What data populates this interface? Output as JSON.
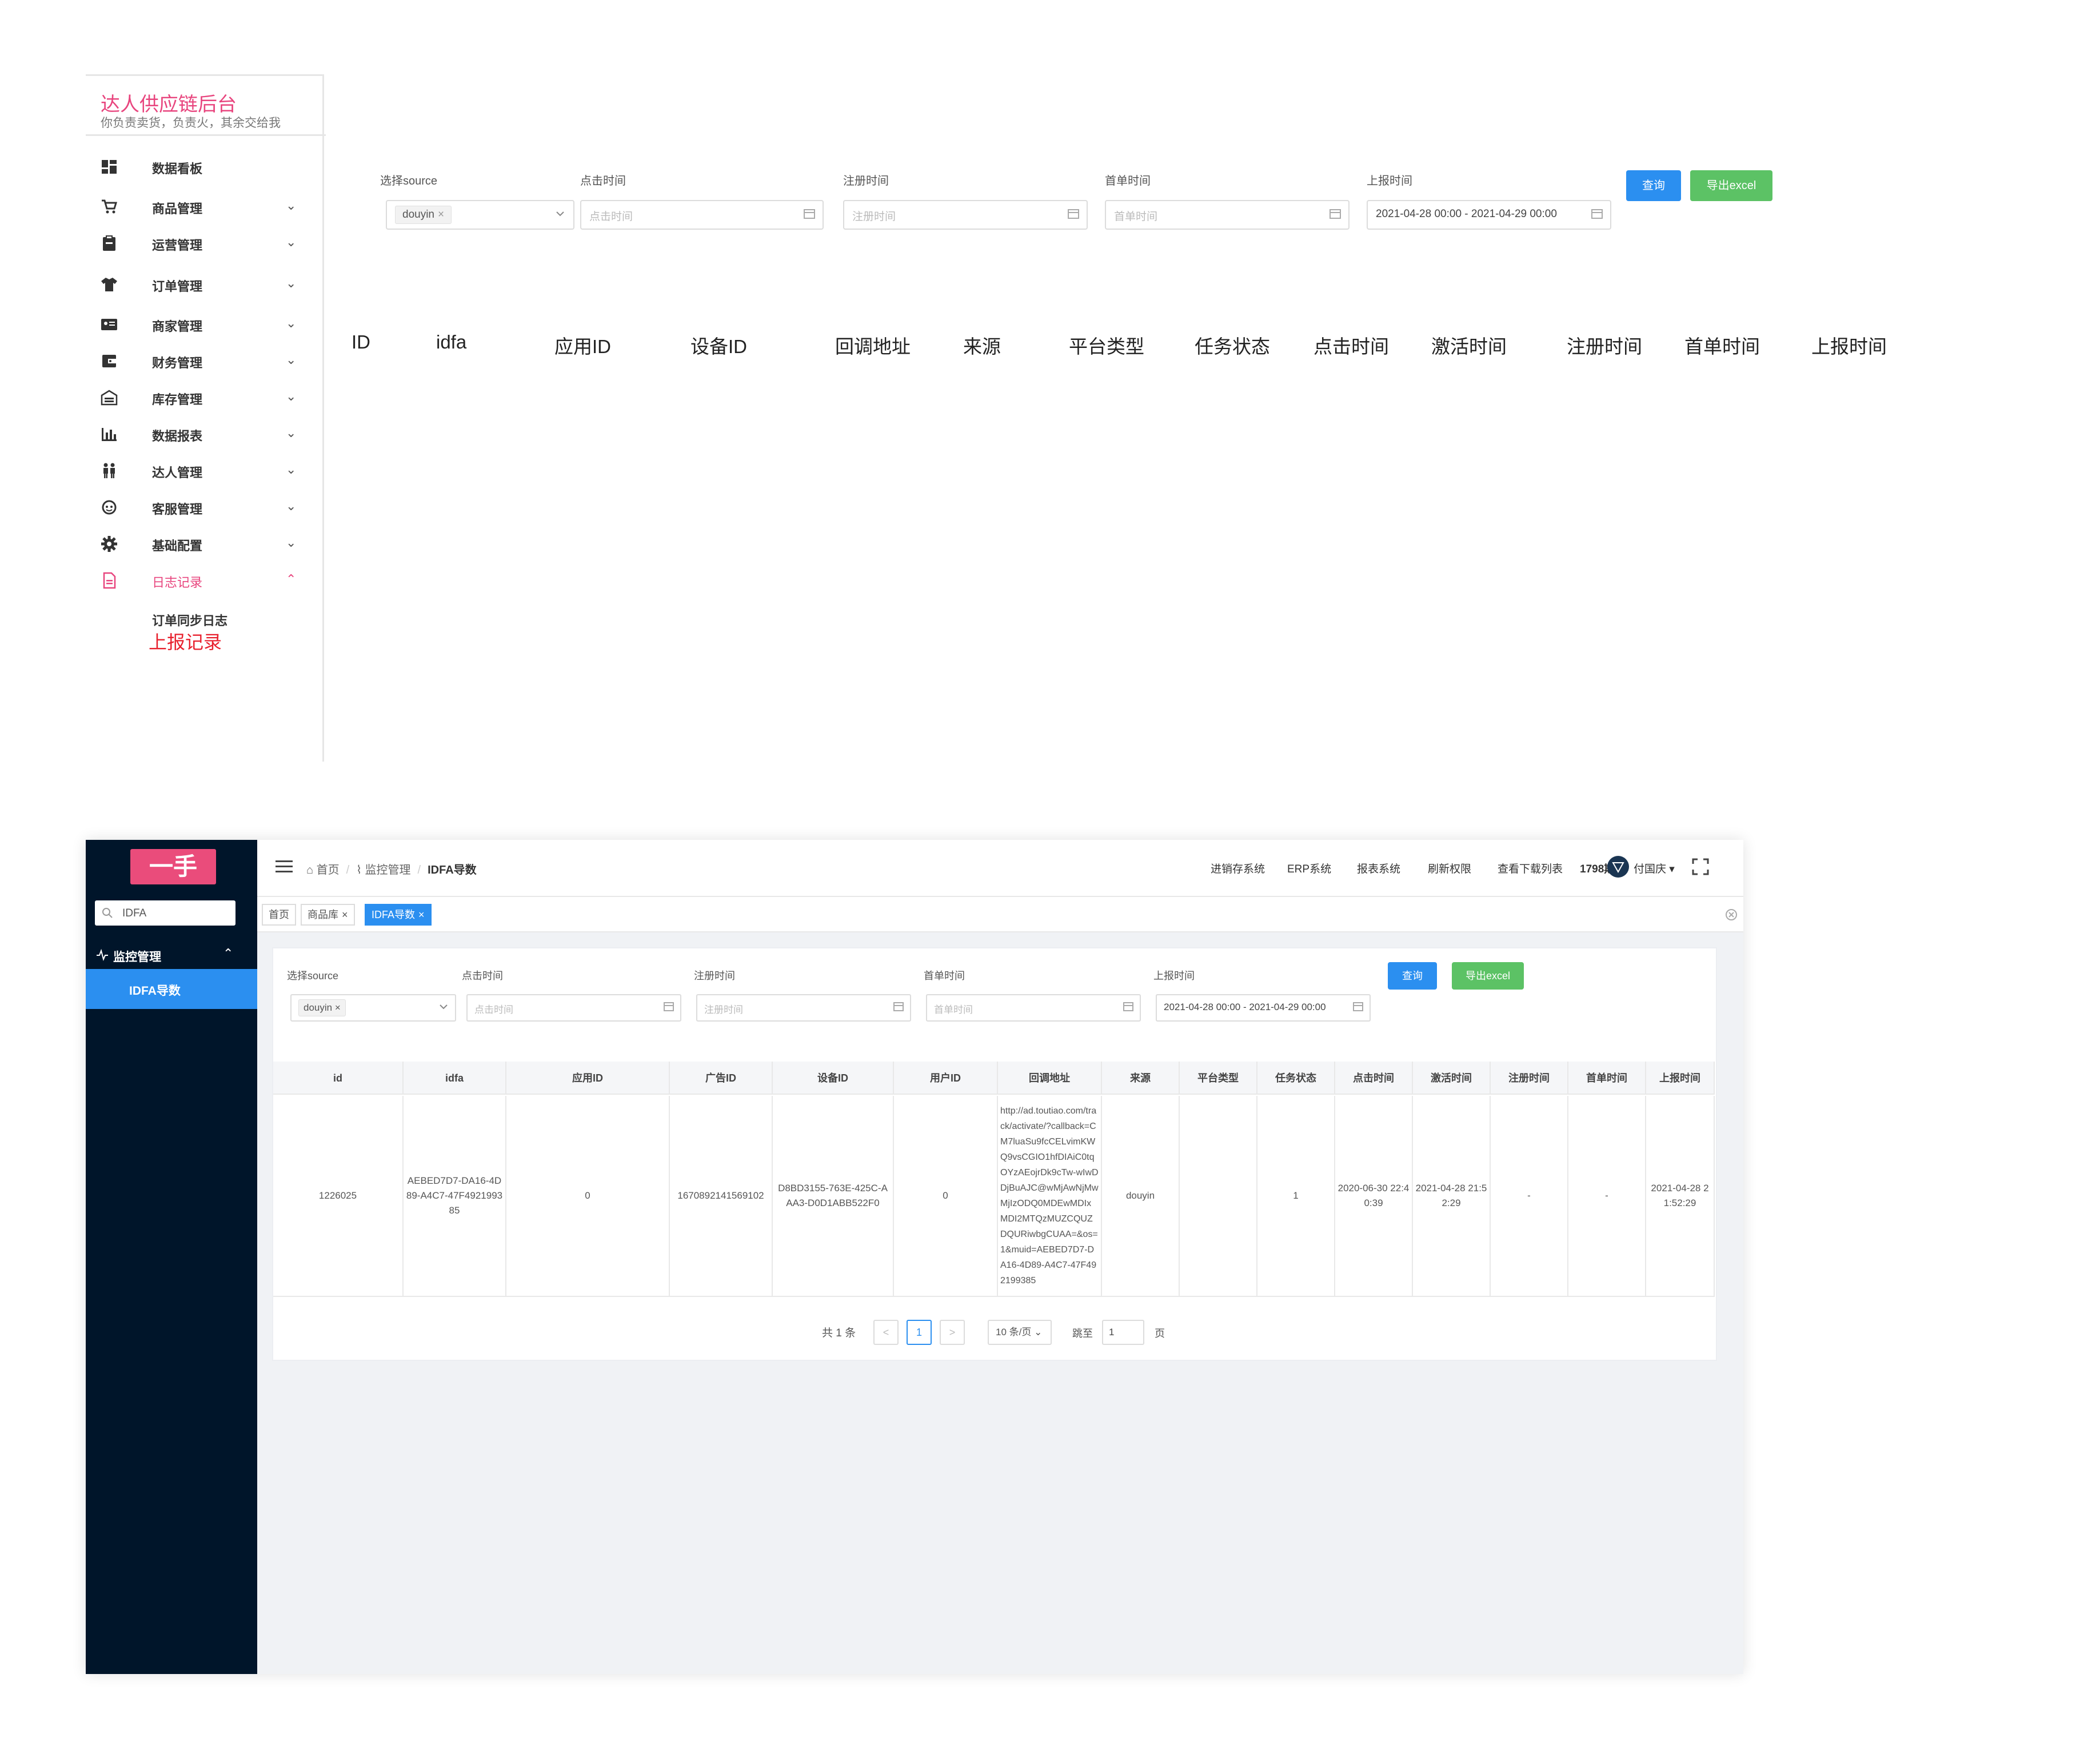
{
  "panel_a": {
    "brand": {
      "title": "达人供应链后台",
      "subtitle": "你负责卖货，负责火，其余交给我"
    },
    "menu": [
      {
        "label": "数据看板",
        "icon": "dashboard-icon",
        "chev": ""
      },
      {
        "label": "商品管理",
        "icon": "cart-icon",
        "chev": "⌄"
      },
      {
        "label": "运营管理",
        "icon": "clipboard-icon",
        "chev": "⌄"
      },
      {
        "label": "订单管理",
        "icon": "shirt-icon",
        "chev": "⌄"
      },
      {
        "label": "商家管理",
        "icon": "id-card-icon",
        "chev": "⌄"
      },
      {
        "label": "财务管理",
        "icon": "wallet-icon",
        "chev": "⌄"
      },
      {
        "label": "库存管理",
        "icon": "warehouse-icon",
        "chev": "⌄"
      },
      {
        "label": "数据报表",
        "icon": "bar-chart-icon",
        "chev": "⌄"
      },
      {
        "label": "达人管理",
        "icon": "people-icon",
        "chev": "⌄"
      },
      {
        "label": "客服管理",
        "icon": "support-icon",
        "chev": "⌄"
      },
      {
        "label": "基础配置",
        "icon": "gear-icon",
        "chev": "⌄"
      },
      {
        "label": "日志记录",
        "icon": "document-icon",
        "chev": "⌃"
      }
    ],
    "submenu": {
      "item1": "订单同步日志",
      "item2": "上报记录"
    },
    "filters": {
      "source_label": "选择source",
      "source_value": "douyin",
      "click_label": "点击时间",
      "click_placeholder": "点击时间",
      "register_label": "注册时间",
      "register_placeholder": "注册时间",
      "first_order_label": "首单时间",
      "first_order_placeholder": "首单时间",
      "report_label": "上报时间",
      "report_value": "2021-04-28 00:00 - 2021-04-29 00:00",
      "query_button": "查询",
      "export_button": "导出excel"
    },
    "columns": [
      "ID",
      "idfa",
      "应用ID",
      "设备ID",
      "回调地址",
      "来源",
      "平台类型",
      "任务状态",
      "点击时间",
      "激活时间",
      "注册时间",
      "首单时间",
      "上报时间"
    ]
  },
  "panel_b": {
    "logo": "一手",
    "search_value": "IDFA",
    "menu_group": "监控管理",
    "menu_active": "IDFA导数",
    "breadcrumb": {
      "home": "首页",
      "section": "监控管理",
      "current": "IDFA导数"
    },
    "top_nav": [
      "进销存系统",
      "ERP系统",
      "报表系统",
      "刷新权限",
      "查看下载列表",
      "1798期"
    ],
    "user_name": "付国庆 ▾",
    "tabs": [
      {
        "label": "首页",
        "closable": ""
      },
      {
        "label": "商品库",
        "closable": "×"
      },
      {
        "label": "IDFA导数",
        "closable": "×"
      }
    ],
    "filters": {
      "source_label": "选择source",
      "source_value": "douyin",
      "click_label": "点击时间",
      "click_placeholder": "点击时间",
      "register_label": "注册时间",
      "register_placeholder": "注册时间",
      "first_order_label": "首单时间",
      "first_order_placeholder": "首单时间",
      "report_label": "上报时间",
      "report_value": "2021-04-28 00:00 - 2021-04-29 00:00",
      "query_button": "查询",
      "export_button": "导出excel"
    },
    "table": {
      "headers": [
        "id",
        "idfa",
        "应用ID",
        "广告ID",
        "设备ID",
        "用户ID",
        "回调地址",
        "来源",
        "平台类型",
        "任务状态",
        "点击时间",
        "激活时间",
        "注册时间",
        "首单时间",
        "上报时间"
      ],
      "row": [
        "1226025",
        "AEBED7D7-DA16-4D89-A4C7-47F492199385",
        "0",
        "1670892141569102",
        "D8BD3155-763E-425C-AAA3-D0D1ABB522F0",
        "0",
        "http://ad.toutiao.com/track/activate/?callback=CM7luaSu9fcCELvimKWQ9vsCGIO1hfDIAiC0tqOYzAEojrDk9cTw-wIwDDjBuAJC@wMjAwNjMwMjIzODQ0MDEwMDIxMDI2MTQzMUZCQUZDQURiwbgCUAA=&os=1&muid=AEBED7D7-DA16-4D89-A4C7-47F492199385",
        "douyin",
        "",
        "1",
        "2020-06-30 22:40:39",
        "2021-04-28 21:52:29",
        "-",
        "-",
        "2021-04-28 21:52:29"
      ]
    },
    "pager": {
      "total": "共 1 条",
      "prev": "<",
      "current": "1",
      "next": ">",
      "page_size": "10 条/页 ⌄",
      "goto_label": "跳至",
      "goto_value": "1",
      "page_suffix": "页"
    }
  }
}
